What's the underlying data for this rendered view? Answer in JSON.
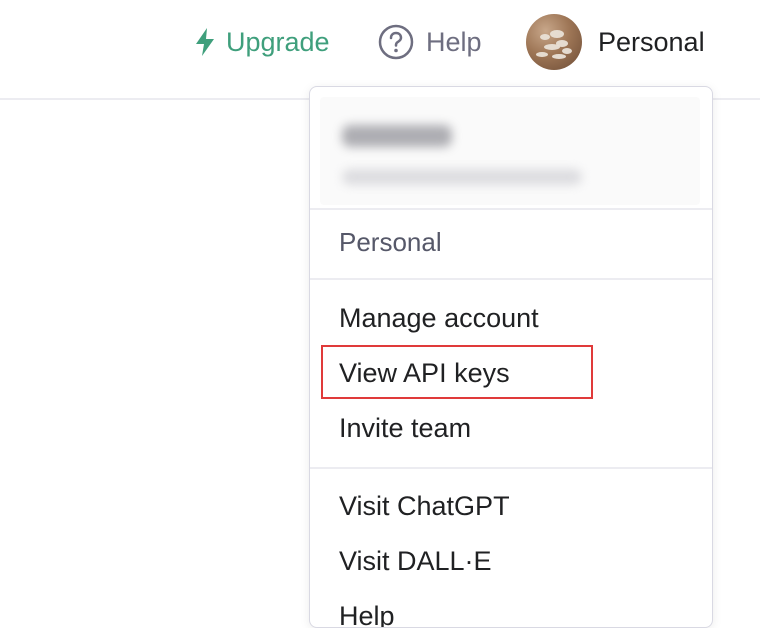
{
  "header": {
    "upgrade_label": "Upgrade",
    "help_label": "Help",
    "account_label": "Personal",
    "accent_color": "#3f9f7c"
  },
  "dropdown": {
    "section_title": "Personal",
    "account_items": [
      {
        "label": "Manage account"
      },
      {
        "label": "View API keys"
      },
      {
        "label": "Invite team"
      }
    ],
    "external_items": [
      {
        "label": "Visit ChatGPT"
      },
      {
        "label": "Visit DALL·E"
      },
      {
        "label": "Help"
      }
    ],
    "highlight_color": "#e03a3a"
  }
}
